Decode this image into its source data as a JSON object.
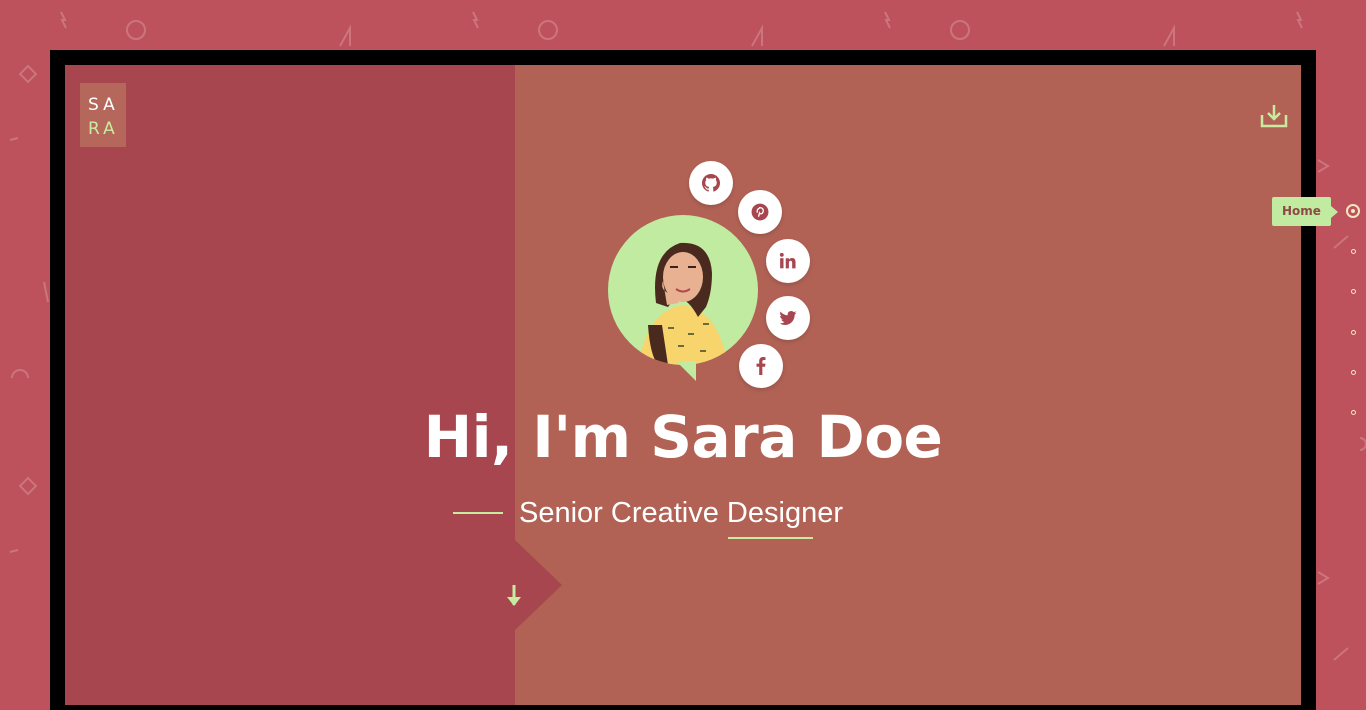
{
  "logo": {
    "line1": "SA",
    "line2": "RA"
  },
  "hero": {
    "headline": "Hi, I'm Sara Doe",
    "subtitle": "Senior Creative Designer"
  },
  "social_links": [
    {
      "icon": "github-icon"
    },
    {
      "icon": "pinterest-icon"
    },
    {
      "icon": "linkedin-icon"
    },
    {
      "icon": "twitter-icon"
    },
    {
      "icon": "facebook-icon"
    }
  ],
  "side_nav": {
    "active_label": "Home",
    "dot_count": 6
  },
  "colors": {
    "page_bg": "#bd515c",
    "panel_left": "#a7464e",
    "panel_right": "#b16255",
    "accent": "#c8ec9f",
    "avatar_bg": "#c0eba0"
  }
}
